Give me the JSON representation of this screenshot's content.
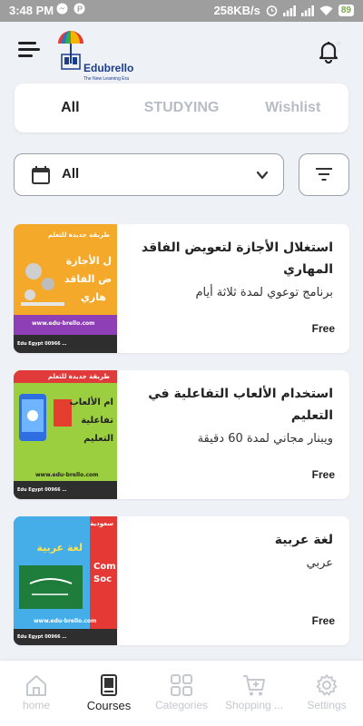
{
  "status_bar": {
    "time": "3:48 PM",
    "network_speed": "258KB/s",
    "battery": "89"
  },
  "app": {
    "logo_name": "Edubrello",
    "logo_tagline": "The New Learning Era"
  },
  "tabs": [
    {
      "label": "All",
      "active": true
    },
    {
      "label": "STUDYING",
      "active": false
    },
    {
      "label": "Wishlist",
      "active": false
    }
  ],
  "filter": {
    "selected": "All"
  },
  "courses": [
    {
      "title": "استغلال الأجازة لتعويض الفاقد المهاري",
      "subtitle": "برنامج توعوي لمدة ثلاثة أيام",
      "price": "Free"
    },
    {
      "title": "استخدام الألعاب التفاعلية في التعليم",
      "subtitle": "ويبنار مجاني لمدة 60 دقيقة",
      "price": "Free"
    },
    {
      "title": "لغة عربية",
      "subtitle": "عربي",
      "price": "Free"
    }
  ],
  "bottom_nav": [
    {
      "label": "home",
      "icon": "home-icon",
      "active": false
    },
    {
      "label": "Courses",
      "icon": "book-icon",
      "active": true
    },
    {
      "label": "Categories",
      "icon": "grid-icon",
      "active": false
    },
    {
      "label": "Shopping ...",
      "icon": "cart-icon",
      "active": false
    },
    {
      "label": "Settings",
      "icon": "gear-icon",
      "active": false
    }
  ],
  "colors": {
    "background": "#eef1f6",
    "active_text": "#222222",
    "inactive_text": "#c4c8cf",
    "brand_blue": "#1b3d8f"
  }
}
